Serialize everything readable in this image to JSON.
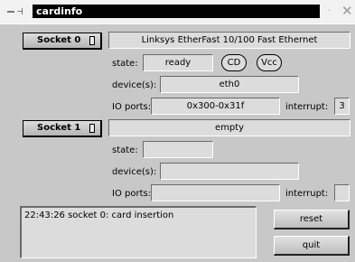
{
  "window": {
    "title": "cardinfo"
  },
  "socket0": {
    "button_label": "Socket 0",
    "card_name": "Linksys EtherFast 10/100 Fast Ethernet",
    "state_label": "state:",
    "state_value": "ready",
    "cd_label": "CD",
    "vcc_label": "Vcc",
    "devices_label": "device(s):",
    "devices_value": "eth0",
    "io_label": "IO ports:",
    "io_value": "0x300-0x31f",
    "interrupt_label": "interrupt:",
    "interrupt_value": "3"
  },
  "socket1": {
    "button_label": "Socket 1",
    "card_name": "empty",
    "state_label": "state:",
    "state_value": "",
    "devices_label": "device(s):",
    "devices_value": "",
    "io_label": "IO ports:",
    "io_value": "",
    "interrupt_label": "interrupt:",
    "interrupt_value": ""
  },
  "log": {
    "text": "22:43:26  socket 0: card insertion"
  },
  "actions": {
    "reset_label": "reset",
    "quit_label": "quit"
  }
}
